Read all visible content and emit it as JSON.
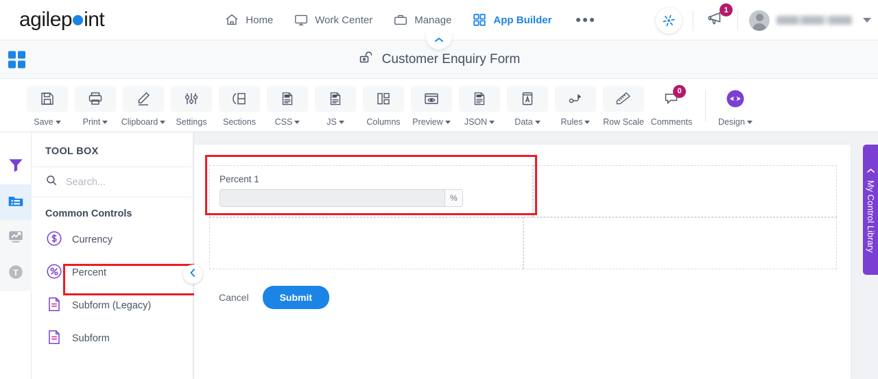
{
  "brand": {
    "name_part1": "agilep",
    "name_part2": "int",
    "accent_color": "#1b84e7"
  },
  "topnav": {
    "items": [
      {
        "label": "Home",
        "icon": "home-icon",
        "active": false
      },
      {
        "label": "Work Center",
        "icon": "monitor-icon",
        "active": false
      },
      {
        "label": "Manage",
        "icon": "briefcase-icon",
        "active": false
      },
      {
        "label": "App Builder",
        "icon": "grid-icon",
        "active": true
      }
    ],
    "overflow": "more-icon",
    "apps_icon": "pinwheel-icon",
    "announcements": {
      "icon": "megaphone-icon",
      "badge": "1",
      "badge_color": "#b5196b"
    },
    "profile": {
      "icon": "avatar-icon",
      "name": "",
      "caret": "chevron-down-icon"
    }
  },
  "formbar": {
    "grid_icon": "app-grid-icon",
    "lock_icon": "unlocked-icon",
    "title": "Customer Enquiry Form",
    "collapse_icon": "chevron-up-icon"
  },
  "toolbar": {
    "items": [
      {
        "label": "Save",
        "icon": "save-icon",
        "caret": true
      },
      {
        "label": "Print",
        "icon": "print-icon",
        "caret": true
      },
      {
        "label": "Clipboard",
        "icon": "pencil-icon",
        "caret": true
      },
      {
        "label": "Settings",
        "icon": "sliders-icon",
        "caret": false
      },
      {
        "label": "Sections",
        "icon": "sections-icon",
        "caret": false
      },
      {
        "label": "CSS",
        "icon": "css-file-icon",
        "caret": true
      },
      {
        "label": "JS",
        "icon": "js-file-icon",
        "caret": true
      },
      {
        "label": "Columns",
        "icon": "columns-icon",
        "caret": false
      },
      {
        "label": "Preview",
        "icon": "eye-window-icon",
        "caret": true
      },
      {
        "label": "JSON",
        "icon": "json-file-icon",
        "caret": true
      },
      {
        "label": "Data",
        "icon": "data-book-icon",
        "caret": true
      },
      {
        "label": "Rules",
        "icon": "rules-icon",
        "caret": true
      },
      {
        "label": "Row Scale",
        "icon": "ruler-icon",
        "caret": false
      },
      {
        "label": "Comments",
        "icon": "comment-icon",
        "caret": false,
        "badge": "0"
      }
    ],
    "design": {
      "label": "Design",
      "icon": "design-eye-icon",
      "caret": true,
      "color": "#7b3fd4"
    }
  },
  "rail": {
    "items": [
      {
        "name": "filter-icon",
        "state": "normal"
      },
      {
        "name": "toolbox-icon",
        "state": "selected"
      },
      {
        "name": "analytics-icon",
        "state": "soft"
      },
      {
        "name": "text-icon",
        "state": "soft"
      }
    ]
  },
  "toolbox": {
    "heading": "TOOL BOX",
    "search": {
      "placeholder": "Search...",
      "value": "",
      "icon": "search-icon"
    },
    "section_title": "Common Controls",
    "controls": [
      {
        "label": "Currency",
        "icon": "currency-icon",
        "highlighted": false
      },
      {
        "label": "Percent",
        "icon": "percent-icon",
        "highlighted": true
      },
      {
        "label": "Subform (Legacy)",
        "icon": "subform-icon",
        "highlighted": false
      },
      {
        "label": "Subform",
        "icon": "subform-icon",
        "highlighted": false
      }
    ],
    "collapse_icon": "chevron-left-icon"
  },
  "canvas": {
    "field": {
      "label": "Percent 1",
      "value": "",
      "suffix": "%",
      "highlighted": true
    },
    "buttons": {
      "cancel": "Cancel",
      "submit": "Submit"
    }
  },
  "right_panel": {
    "label": "My Control Library",
    "icon": "chevron-left-icon",
    "color": "#7b3fd4"
  },
  "highlight_color": "#ed1c24"
}
